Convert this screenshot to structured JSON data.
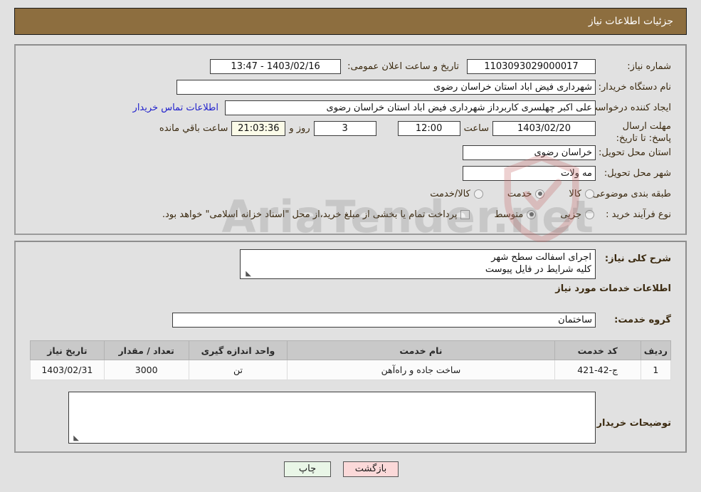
{
  "header": {
    "title": "جزئیات اطلاعات نیاز"
  },
  "form": {
    "need_number": {
      "label": "شماره نیاز:",
      "value": "1103093029000017"
    },
    "public_announce": {
      "label": "تاریخ و ساعت اعلان عمومی:",
      "value": "1403/02/16 - 13:47"
    },
    "buyer_org": {
      "label": "نام دستگاه خریدار:",
      "value": "شهرداری فیض اباد استان خراسان رضوی"
    },
    "creator": {
      "label": "ایجاد کننده درخواست:",
      "value": "علی اکبر چهلسری کاربرداز شهرداری فیض اباد استان خراسان رضوی"
    },
    "contact_link": "اطلاعات تماس خریدار",
    "deadline": {
      "label": "مهلت ارسال پاسخ: تا تاریخ:",
      "date": "1403/02/20",
      "time_label": "ساعت",
      "time": "12:00",
      "days": "3",
      "days_suffix": "روز و",
      "countdown": "21:03:36",
      "countdown_suffix": "ساعت باقي مانده"
    },
    "province": {
      "label": "استان محل تحویل:",
      "value": "خراسان رضوی"
    },
    "city": {
      "label": "شهر محل تحویل:",
      "value": "مه ولات"
    },
    "category": {
      "label": "طبقه بندی موضوعی:",
      "options": [
        {
          "label": "کالا",
          "selected": false
        },
        {
          "label": "خدمت",
          "selected": true
        },
        {
          "label": "کالا/خدمت",
          "selected": false
        }
      ]
    },
    "purchase_type": {
      "label": "نوع فرآیند خرید :",
      "options": [
        {
          "label": "جزیی",
          "selected": false
        },
        {
          "label": "متوسط",
          "selected": true
        }
      ],
      "checkbox_label": "پرداخت تمام یا بخشی از مبلغ خرید،از محل \"اسناد خزانه اسلامی\" خواهد بود.",
      "checkbox_checked": false
    },
    "general_desc": {
      "label": "شرح کلی نیاز:",
      "value": "اجرای اسفالت سطح شهر\nکلیه شرایط در فایل پیوست"
    },
    "services_heading": "اطلاعات خدمات مورد نیاز",
    "service_group": {
      "label": "گروه خدمت:",
      "value": "ساختمان"
    },
    "buyer_notes": {
      "label": "توضیحات خریدار:",
      "value": ""
    }
  },
  "table": {
    "columns": [
      "ردیف",
      "کد خدمت",
      "نام خدمت",
      "واحد اندازه گیری",
      "تعداد / مقدار",
      "تاریخ نیاز"
    ],
    "rows": [
      {
        "index": "1",
        "code": "ج-42-421",
        "name": "ساخت جاده و راه‌آهن",
        "unit": "تن",
        "qty": "3000",
        "date": "1403/02/31"
      }
    ]
  },
  "footer": {
    "print_label": "چاپ",
    "back_label": "بازگشت"
  },
  "watermark": {
    "text": "AriaTender.net"
  },
  "colors": {
    "header_bg": "#8d6e3f",
    "label": "#3b2a10",
    "link": "#2222cc",
    "print_bg": "#e9f6e7",
    "back_bg": "#fbd9d9",
    "countdown_bg": "#fbfbe8"
  }
}
